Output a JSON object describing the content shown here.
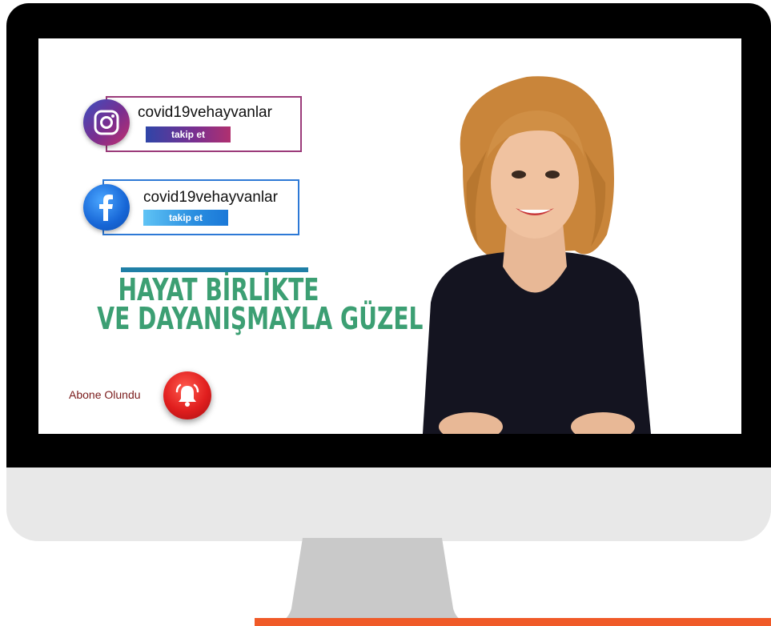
{
  "instagram": {
    "handle": "covid19vehayvanlar",
    "follow_label": "takip et",
    "icon": "instagram-icon"
  },
  "facebook": {
    "handle": "covid19vehayvanlar",
    "follow_label": "takip et",
    "icon": "facebook-icon"
  },
  "headline": {
    "line1": "HAYAT BİRLİKTE",
    "line2": "VE DAYANIŞMAYLA GÜZEL"
  },
  "subscribe": {
    "label": "Abone Olundu",
    "icon": "bell-icon"
  },
  "colors": {
    "headline": "#3c9f73",
    "accent_line": "#1f7fa6",
    "base_bar": "#f05a28",
    "bell": "#e01e1e"
  }
}
